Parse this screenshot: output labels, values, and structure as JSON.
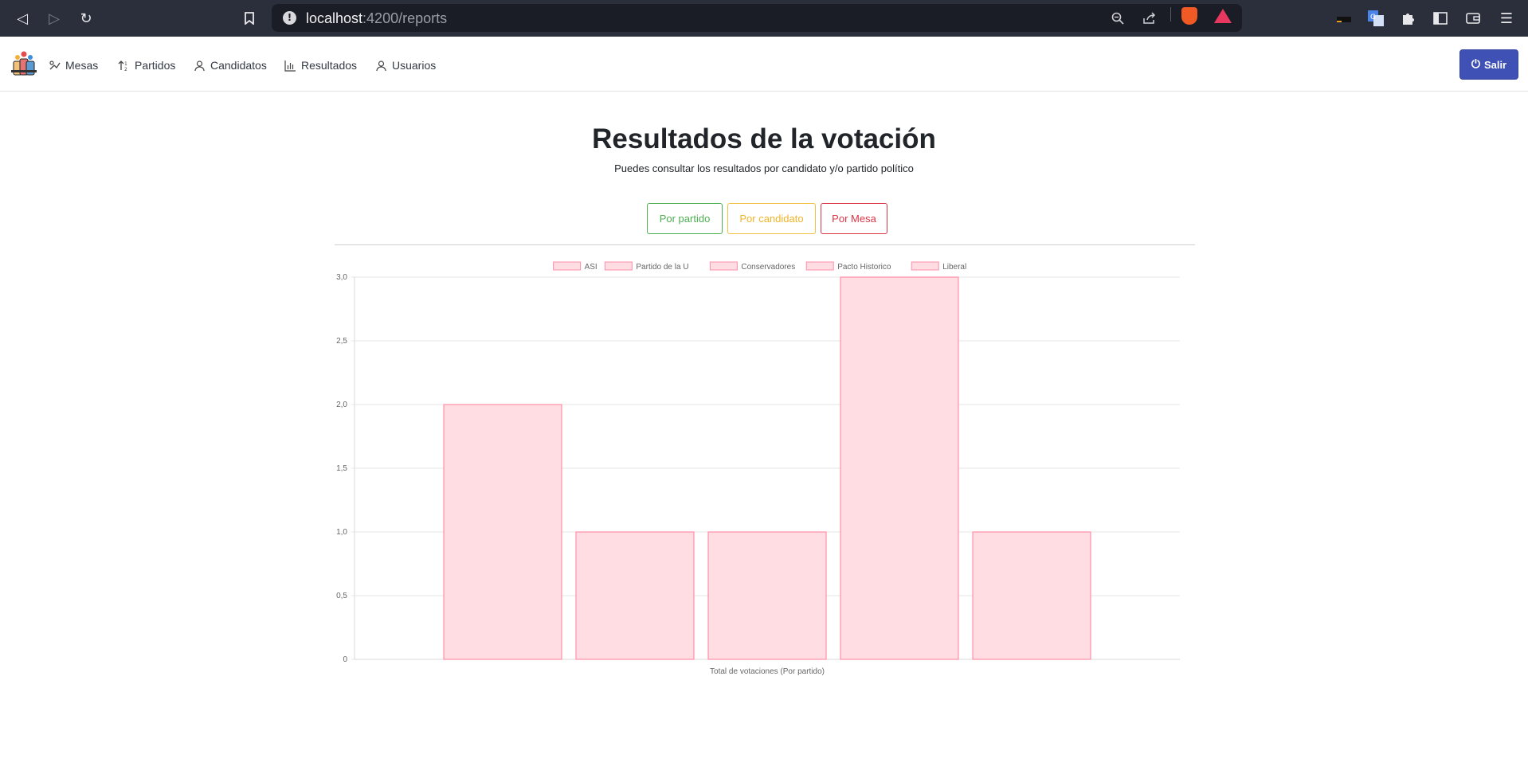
{
  "browser": {
    "url_host": "localhost",
    "url_rest": ":4200/reports"
  },
  "navbar": {
    "items": [
      {
        "label": "Mesas",
        "icon": "table-icon"
      },
      {
        "label": "Partidos",
        "icon": "sort-icon"
      },
      {
        "label": "Candidatos",
        "icon": "user-icon"
      },
      {
        "label": "Resultados",
        "icon": "bar-chart-icon"
      },
      {
        "label": "Usuarios",
        "icon": "user-icon"
      }
    ],
    "logout_label": "Salir"
  },
  "main": {
    "title": "Resultados de la votación",
    "subtitle": "Puedes consultar los resultados por candidato y/o partido político",
    "buttons": {
      "by_party": "Por partido",
      "by_candidate": "Por candidato",
      "by_table": "Por Mesa"
    }
  },
  "colors": {
    "bar_fill": "#ffdde3",
    "bar_stroke": "#ff8fa8",
    "primary": "#3f51b5",
    "success": "#4caf50",
    "warning": "#f0b429",
    "danger": "#dc3545"
  },
  "chart_data": {
    "type": "bar",
    "categories": [
      "ASI",
      "Partido de la U",
      "Conservadores",
      "Pacto Historico",
      "Liberal"
    ],
    "values": [
      2,
      1,
      1,
      3,
      1
    ],
    "legend": [
      "ASI",
      "Partido de la U",
      "Conservadores",
      "Pacto Historico",
      "Liberal"
    ],
    "legend_position": "top",
    "xlabel": "Total de votaciones (Por partido)",
    "ylabel": "",
    "ylim": [
      0,
      3
    ],
    "yticks": [
      "0",
      "0,5",
      "1,0",
      "1,5",
      "2,0",
      "2,5",
      "3,0"
    ],
    "grid": true
  }
}
